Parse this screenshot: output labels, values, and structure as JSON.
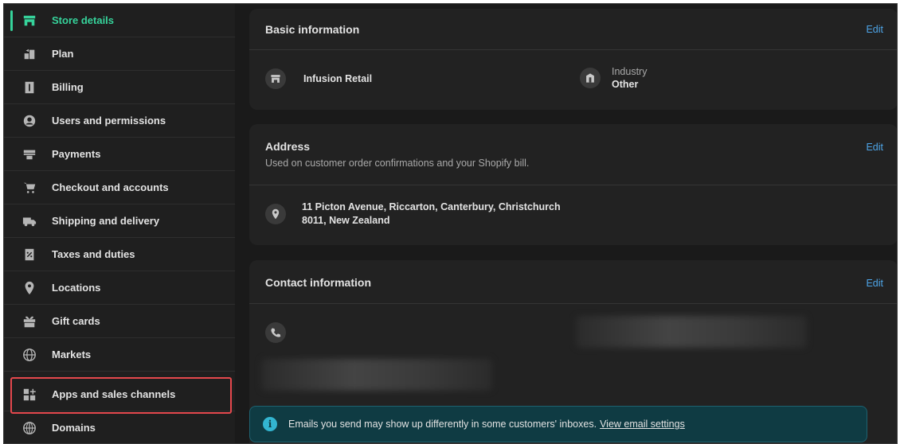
{
  "sidebar": {
    "items": [
      {
        "label": "Store details",
        "icon": "store-icon",
        "active": true
      },
      {
        "label": "Plan",
        "icon": "plan-icon"
      },
      {
        "label": "Billing",
        "icon": "billing-icon"
      },
      {
        "label": "Users and permissions",
        "icon": "user-icon"
      },
      {
        "label": "Payments",
        "icon": "payments-icon"
      },
      {
        "label": "Checkout and accounts",
        "icon": "cart-icon"
      },
      {
        "label": "Shipping and delivery",
        "icon": "truck-icon"
      },
      {
        "label": "Taxes and duties",
        "icon": "tax-icon"
      },
      {
        "label": "Locations",
        "icon": "location-pin-icon"
      },
      {
        "label": "Gift cards",
        "icon": "gift-icon"
      },
      {
        "label": "Markets",
        "icon": "globe-icon"
      },
      {
        "label": "Apps and sales channels",
        "icon": "apps-icon",
        "highlighted": true
      },
      {
        "label": "Domains",
        "icon": "domain-globe-icon"
      }
    ]
  },
  "basic_info": {
    "title": "Basic information",
    "edit": "Edit",
    "store_name": "Infusion Retail",
    "industry_label": "Industry",
    "industry_value": "Other"
  },
  "address": {
    "title": "Address",
    "subtitle": "Used on customer order confirmations and your Shopify bill.",
    "edit": "Edit",
    "line1": "11 Picton Avenue, Riccarton, Canterbury, Christchurch",
    "line2": "8011, New Zealand"
  },
  "contact": {
    "title": "Contact information",
    "edit": "Edit"
  },
  "banner": {
    "text": "Emails you send may show up differently in some customers' inboxes.",
    "link": "View email settings"
  },
  "colors": {
    "accent": "#36d39b",
    "link": "#4ea5e8",
    "highlight": "#e5484d",
    "background": "#1a1a1a"
  }
}
